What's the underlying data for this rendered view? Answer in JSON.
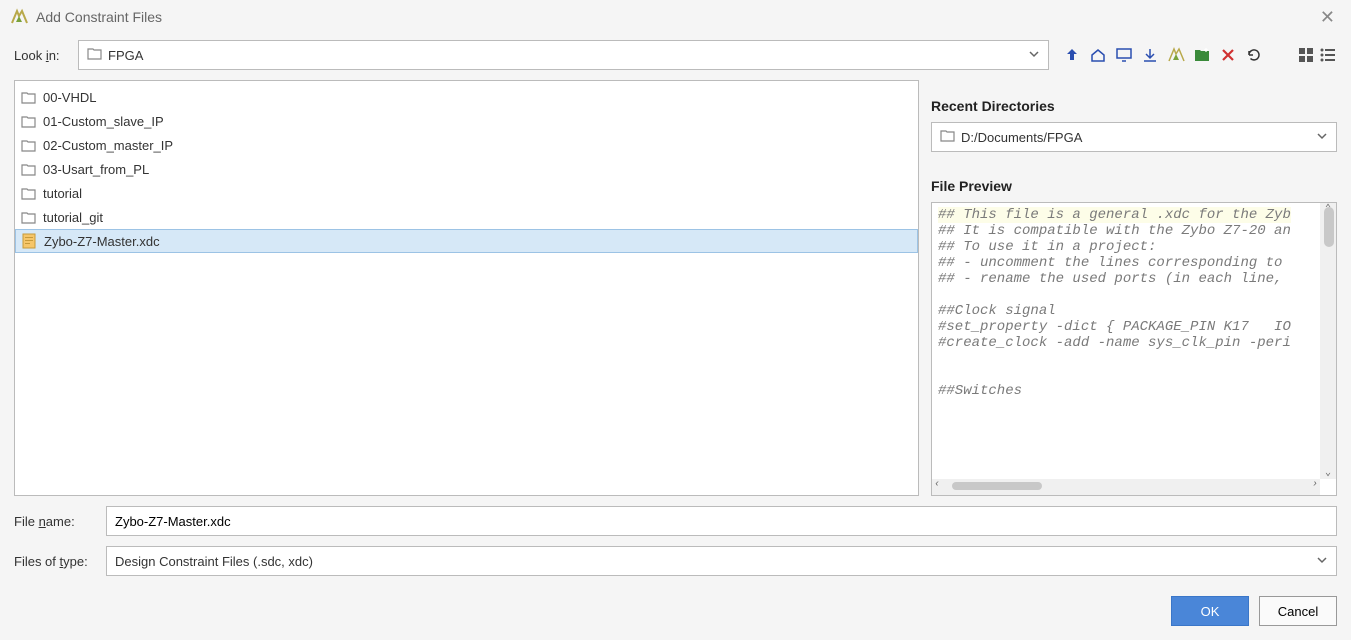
{
  "window": {
    "title": "Add Constraint Files"
  },
  "lookin": {
    "label_html": "Look in:",
    "value": "FPGA"
  },
  "toolbar_icons": {
    "up": "up-arrow-icon",
    "home": "home-icon",
    "desktop": "desktop-icon",
    "download": "download-icon",
    "vivado": "vivado-icon",
    "newfolder": "new-folder-icon",
    "delete": "delete-icon",
    "refresh": "refresh-icon",
    "grid": "grid-view-icon",
    "list": "list-view-icon"
  },
  "files": [
    {
      "name": "00-VHDL",
      "type": "folder",
      "selected": false
    },
    {
      "name": "01-Custom_slave_IP",
      "type": "folder",
      "selected": false
    },
    {
      "name": "02-Custom_master_IP",
      "type": "folder",
      "selected": false
    },
    {
      "name": "03-Usart_from_PL",
      "type": "folder",
      "selected": false
    },
    {
      "name": "tutorial",
      "type": "folder",
      "selected": false
    },
    {
      "name": "tutorial_git",
      "type": "folder",
      "selected": false
    },
    {
      "name": "Zybo-Z7-Master.xdc",
      "type": "xdc",
      "selected": true
    }
  ],
  "recent": {
    "heading": "Recent Directories",
    "value": "D:/Documents/FPGA"
  },
  "preview": {
    "heading": "File Preview",
    "lines": [
      "## This file is a general .xdc for the Zyb",
      "## It is compatible with the Zybo Z7-20 an",
      "## To use it in a project:",
      "## - uncomment the lines corresponding to ",
      "## - rename the used ports (in each line, ",
      "",
      "##Clock signal",
      "#set_property -dict { PACKAGE_PIN K17   IO",
      "#create_clock -add -name sys_clk_pin -peri",
      "",
      "",
      "##Switches"
    ]
  },
  "filename": {
    "label": "File name:",
    "value": "Zybo-Z7-Master.xdc"
  },
  "filetype": {
    "label": "Files of type:",
    "value": "Design Constraint Files (.sdc, xdc)"
  },
  "buttons": {
    "ok": "OK",
    "cancel": "Cancel"
  }
}
